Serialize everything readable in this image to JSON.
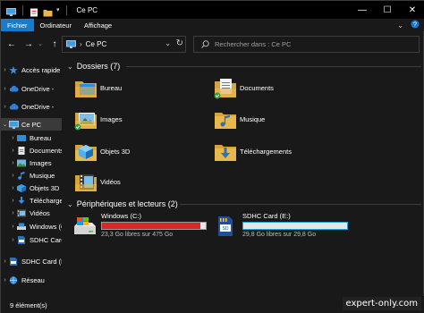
{
  "window": {
    "title": "Ce PC",
    "controls": {
      "minimize": "—",
      "maximize": "☐",
      "close": "✕"
    }
  },
  "ribbon": {
    "tabs": [
      "Fichier",
      "Ordinateur",
      "Affichage"
    ],
    "active_tab": "Fichier"
  },
  "navigation": {
    "address": "Ce PC",
    "search_placeholder": "Rechercher dans : Ce PC"
  },
  "sidebar": {
    "items": [
      {
        "label": "Accès rapide",
        "icon": "star-icon"
      },
      {
        "label": "OneDrive -",
        "icon": "cloud-icon"
      },
      {
        "label": "OneDrive -",
        "icon": "cloud-icon"
      },
      {
        "label": "Ce PC",
        "icon": "computer-icon"
      },
      {
        "label": "Bureau",
        "icon": "desktop-folder-icon"
      },
      {
        "label": "Documents",
        "icon": "documents-folder-icon"
      },
      {
        "label": "Images",
        "icon": "images-folder-icon"
      },
      {
        "label": "Musique",
        "icon": "music-folder-icon"
      },
      {
        "label": "Objets 3D",
        "icon": "3d-objects-icon"
      },
      {
        "label": "Téléchargements",
        "icon": "download-icon"
      },
      {
        "label": "Vidéos",
        "icon": "videos-folder-icon"
      },
      {
        "label": "Windows (C:)",
        "icon": "drive-icon"
      },
      {
        "label": "SDHC Card (E:)",
        "icon": "sd-card-icon"
      },
      {
        "label": "SDHC Card (E:)",
        "icon": "sd-card-icon"
      },
      {
        "label": "Réseau",
        "icon": "network-icon"
      }
    ]
  },
  "content": {
    "folders_header": "Dossiers (7)",
    "folders": [
      {
        "label": "Bureau",
        "icon": "desktop-folder-icon",
        "synced": false
      },
      {
        "label": "Documents",
        "icon": "documents-folder-icon",
        "synced": true
      },
      {
        "label": "Images",
        "icon": "images-folder-icon",
        "synced": true
      },
      {
        "label": "Musique",
        "icon": "music-folder-icon",
        "synced": false
      },
      {
        "label": "Objets 3D",
        "icon": "3d-objects-icon",
        "synced": false
      },
      {
        "label": "Téléchargements",
        "icon": "download-folder-icon",
        "synced": false
      },
      {
        "label": "Vidéos",
        "icon": "videos-folder-icon",
        "synced": false
      }
    ],
    "drives_header": "Périphériques et lecteurs (2)",
    "drives": [
      {
        "name": "Windows  (C:)",
        "info": "23,3 Go libres sur 475 Go",
        "used_fraction": 0.951,
        "bar_color": "#da2626",
        "icon": "hard-drive-icon"
      },
      {
        "name": "SDHC Card (E:)",
        "info": "29,8 Go libres sur 29,8 Go",
        "used_fraction": 0.0,
        "bar_color": "#26a0da",
        "icon": "sd-card-icon"
      }
    ]
  },
  "status": {
    "item_count": "9 élément(s)",
    "watermark": "expert-only.com"
  },
  "colors": {
    "accent": "#1979ca",
    "folder": "#e8b84a",
    "sync_green": "#2ea043",
    "background": "#191919"
  }
}
